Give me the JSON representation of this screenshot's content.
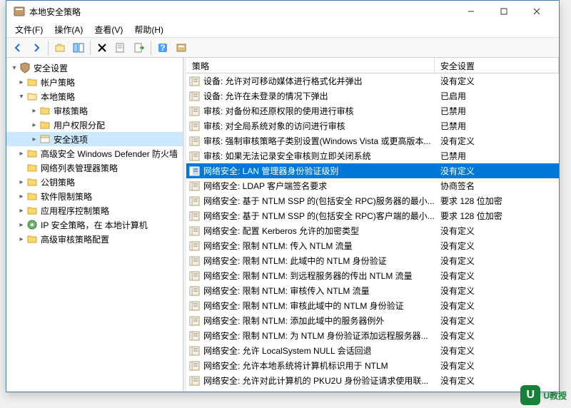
{
  "window": {
    "title": "本地安全策略"
  },
  "menu": {
    "file": "文件(F)",
    "action": "操作(A)",
    "view": "查看(V)",
    "help": "帮助(H)"
  },
  "columns": {
    "policy": "策略",
    "setting": "安全设置"
  },
  "tree": {
    "root": "安全设置",
    "nodes": [
      {
        "label": "帐户策略",
        "expanded": false,
        "depth": 1,
        "children": true
      },
      {
        "label": "本地策略",
        "expanded": true,
        "depth": 1,
        "children": true
      },
      {
        "label": "审核策略",
        "depth": 2,
        "children": true
      },
      {
        "label": "用户权限分配",
        "depth": 2,
        "children": true
      },
      {
        "label": "安全选项",
        "depth": 2,
        "children": true,
        "selected": true,
        "leaf": true
      },
      {
        "label": "高级安全 Windows Defender 防火墙",
        "depth": 1,
        "children": true
      },
      {
        "label": "网络列表管理器策略",
        "depth": 1,
        "children": false
      },
      {
        "label": "公钥策略",
        "depth": 1,
        "children": true
      },
      {
        "label": "软件限制策略",
        "depth": 1,
        "children": true
      },
      {
        "label": "应用程序控制策略",
        "depth": 1,
        "children": true
      },
      {
        "label": "IP 安全策略，在 本地计算机",
        "depth": 1,
        "children": true,
        "iconType": "ip"
      },
      {
        "label": "高级审核策略配置",
        "depth": 1,
        "children": true
      }
    ]
  },
  "rows": [
    {
      "policy": "设备: 允许对可移动媒体进行格式化并弹出",
      "setting": "没有定义"
    },
    {
      "policy": "设备: 允许在未登录的情况下弹出",
      "setting": "已启用"
    },
    {
      "policy": "审核: 对备份和还原权限的使用进行审核",
      "setting": "已禁用"
    },
    {
      "policy": "审核: 对全局系统对象的访问进行审核",
      "setting": "已禁用"
    },
    {
      "policy": "审核: 强制审核策略子类别设置(Windows Vista 或更高版本...",
      "setting": "没有定义"
    },
    {
      "policy": "审核: 如果无法记录安全审核则立即关闭系统",
      "setting": "已禁用"
    },
    {
      "policy": "网络安全: LAN 管理器身份验证级别",
      "setting": "没有定义",
      "selected": true
    },
    {
      "policy": "网络安全: LDAP 客户端签名要求",
      "setting": "协商签名"
    },
    {
      "policy": "网络安全: 基于 NTLM SSP 的(包括安全 RPC)服务器的最小...",
      "setting": "要求 128 位加密"
    },
    {
      "policy": "网络安全: 基于 NTLM SSP 的(包括安全 RPC)客户端的最小...",
      "setting": "要求 128 位加密"
    },
    {
      "policy": "网络安全: 配置 Kerberos 允许的加密类型",
      "setting": "没有定义"
    },
    {
      "policy": "网络安全: 限制 NTLM: 传入 NTLM 流量",
      "setting": "没有定义"
    },
    {
      "policy": "网络安全: 限制 NTLM: 此域中的 NTLM 身份验证",
      "setting": "没有定义"
    },
    {
      "policy": "网络安全: 限制 NTLM: 到远程服务器的传出 NTLM 流量",
      "setting": "没有定义"
    },
    {
      "policy": "网络安全: 限制 NTLM: 审核传入 NTLM 流量",
      "setting": "没有定义"
    },
    {
      "policy": "网络安全: 限制 NTLM: 审核此域中的 NTLM 身份验证",
      "setting": "没有定义"
    },
    {
      "policy": "网络安全: 限制 NTLM: 添加此域中的服务器例外",
      "setting": "没有定义"
    },
    {
      "policy": "网络安全: 限制 NTLM: 为 NTLM 身份验证添加远程服务器...",
      "setting": "没有定义"
    },
    {
      "policy": "网络安全: 允许 LocalSystem NULL 会话回退",
      "setting": "没有定义"
    },
    {
      "policy": "网络安全: 允许本地系统将计算机标识用于 NTLM",
      "setting": "没有定义"
    },
    {
      "policy": "网络安全: 允许对此计算机的 PKU2U 身份验证请求使用联...",
      "setting": "没有定义"
    }
  ],
  "watermark": {
    "text": "U教授"
  }
}
